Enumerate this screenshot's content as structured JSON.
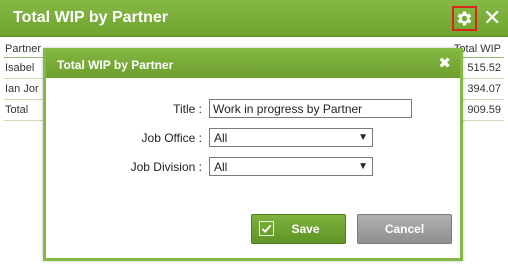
{
  "widget": {
    "title": "Total WIP by Partner",
    "close_glyph": "✕",
    "icons": {
      "settings": "gear-icon",
      "close": "close-icon"
    },
    "table": {
      "header": {
        "left": "Partner",
        "right": "Total WIP"
      },
      "rows": [
        {
          "left": "Isabel",
          "right": "515.52"
        },
        {
          "left": "Ian Jor",
          "right": "394.07"
        },
        {
          "left": "Total",
          "right": "909.59"
        }
      ]
    }
  },
  "dialog": {
    "title": "Total WIP by Partner",
    "close_glyph": "✖",
    "fields": {
      "title": {
        "label": "Title :",
        "value": "Work in progress by Partner"
      },
      "job_office": {
        "label": "Job Office :",
        "value": "All"
      },
      "job_division": {
        "label": "Job Division :",
        "value": "All"
      }
    },
    "buttons": {
      "save": "Save",
      "cancel": "Cancel"
    }
  },
  "colors": {
    "header_green": "#78ad3a",
    "highlight_red": "#d9261c",
    "save_green": "#6ea32e",
    "cancel_gray": "#a0a0a0"
  }
}
